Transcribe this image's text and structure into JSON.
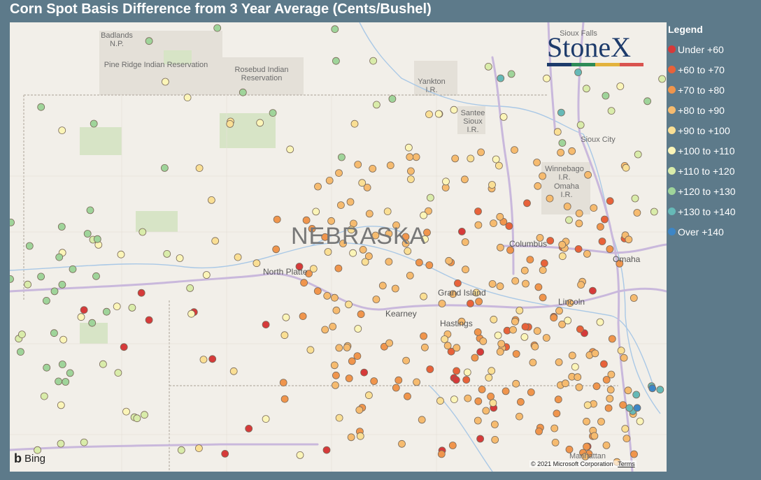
{
  "title": "Corn Spot Basis Difference from 3 Year Average (Cents/Bushel)",
  "legend": {
    "title": "Legend",
    "items": [
      {
        "label": "Under +60",
        "color": "#d63a3a"
      },
      {
        "label": "+60 to +70",
        "color": "#e8623a"
      },
      {
        "label": "+70 to +80",
        "color": "#f0954c"
      },
      {
        "label": "+80 to +90",
        "color": "#f6bb6f"
      },
      {
        "label": "+90 to +100",
        "color": "#fadf94"
      },
      {
        "label": "+100 to +110",
        "color": "#fbf5b8"
      },
      {
        "label": "+110 to +120",
        "color": "#d9ecaa"
      },
      {
        "label": "+120 to +130",
        "color": "#9fd49a"
      },
      {
        "label": "+130 to +140",
        "color": "#66b9b7"
      },
      {
        "label": "Over +140",
        "color": "#3d86c6"
      }
    ]
  },
  "map": {
    "state_label": "NEBRASKA",
    "places": [
      {
        "name": "Badlands\nN.P."
      },
      {
        "name": "Pine Ridge Indian Reservation"
      },
      {
        "name": "Rosebud Indian\nReservation"
      },
      {
        "name": "Yankton\nI.R."
      },
      {
        "name": "Santee\nSioux\nI.R."
      },
      {
        "name": "Sioux Falls"
      },
      {
        "name": "Sioux City"
      },
      {
        "name": "Winnebago\nI.R."
      },
      {
        "name": "Omaha\nI.R."
      },
      {
        "name": "Manhattan"
      }
    ],
    "cities": [
      {
        "name": "North Platte"
      },
      {
        "name": "Columbus"
      },
      {
        "name": "Omaha"
      },
      {
        "name": "Grand Island"
      },
      {
        "name": "Kearney"
      },
      {
        "name": "Hastings"
      },
      {
        "name": "Lincoln"
      }
    ]
  },
  "logo": {
    "text": "StoneX",
    "bar_colors": [
      "#1d3b6b",
      "#2e8b57",
      "#e3b23c",
      "#d9534f"
    ]
  },
  "attribution": {
    "bing": "Bing",
    "copyright": "© 2021 Microsoft Corporation",
    "terms": "Terms"
  },
  "stations": {
    "count_by_class": [
      22,
      24,
      70,
      140,
      45,
      40,
      30,
      38,
      8,
      2
    ]
  }
}
